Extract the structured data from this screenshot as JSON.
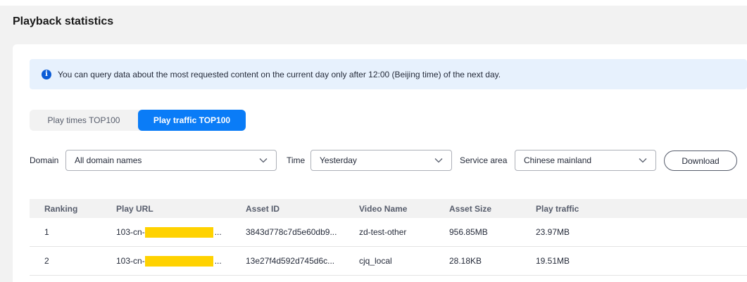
{
  "page": {
    "title": "Playback statistics"
  },
  "notice": {
    "text": "You can query data about the most requested content on the current day only after 12:00 (Beijing time) of the next day."
  },
  "tabs": [
    {
      "label": "Play times TOP100",
      "active": false
    },
    {
      "label": "Play traffic TOP100",
      "active": true
    }
  ],
  "filters": {
    "domain": {
      "label": "Domain",
      "value": "All domain names"
    },
    "time": {
      "label": "Time",
      "value": "Yesterday"
    },
    "service_area": {
      "label": "Service area",
      "value": "Chinese mainland"
    },
    "download_label": "Download"
  },
  "table": {
    "columns": [
      "Ranking",
      "Play URL",
      "Asset ID",
      "Video Name",
      "Asset Size",
      "Play traffic"
    ],
    "rows": [
      {
        "ranking": "1",
        "url_prefix": "103-cn-",
        "url_suffix": "...",
        "asset_id": "3843d778c7d5e60db9...",
        "video_name": "zd-test-other",
        "asset_size": "956.85MB",
        "play_traffic": "23.97MB"
      },
      {
        "ranking": "2",
        "url_prefix": "103-cn-",
        "url_suffix": "...",
        "asset_id": "13e27f4d592d745d6c...",
        "video_name": "cjq_local",
        "asset_size": "28.18KB",
        "play_traffic": "19.51MB"
      }
    ]
  },
  "colors": {
    "accent": "#0a7cf7",
    "notice_bg": "#e7f1fd",
    "redaction": "#ffd200"
  },
  "icons": {
    "notice": "info-icon",
    "select": "chevron-down-icon"
  }
}
